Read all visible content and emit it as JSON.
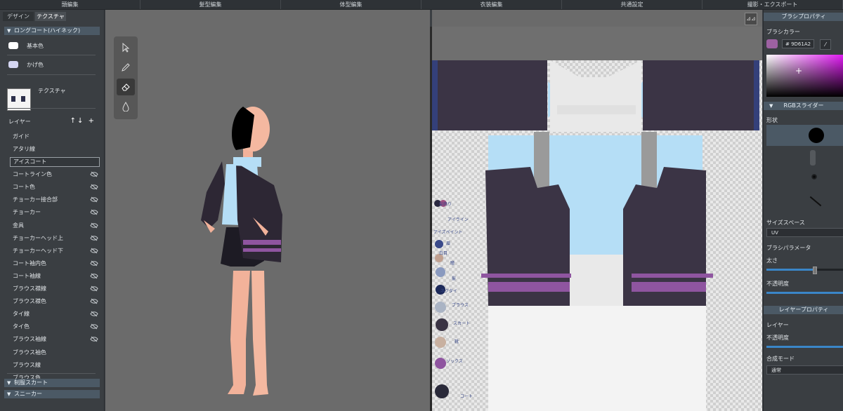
{
  "menu": [
    "頭編集",
    "髪型編集",
    "体型編集",
    "衣装編集",
    "共通設定",
    "撮影・エクスポート"
  ],
  "left": {
    "tabs": [
      "デザイン",
      "テクスチャ"
    ],
    "section_main": "ロングコート(ハイネック)",
    "colors": [
      {
        "label": "基本色",
        "hex": "#FFFFFF"
      },
      {
        "label": "かげ色",
        "hex": "#D4D6F2"
      }
    ],
    "texture_label": "テクスチャ",
    "layer_header": "レイヤー",
    "layers": [
      {
        "name": "ガイド",
        "hidden": false,
        "selected": false
      },
      {
        "name": "アタリ線",
        "hidden": false,
        "selected": false
      },
      {
        "name": "アイスコート",
        "hidden": false,
        "selected": true
      },
      {
        "name": "コートライン色",
        "hidden": true,
        "selected": false
      },
      {
        "name": "コート色",
        "hidden": true,
        "selected": false
      },
      {
        "name": "チョーカー接合部",
        "hidden": true,
        "selected": false
      },
      {
        "name": "チョーカー",
        "hidden": true,
        "selected": false
      },
      {
        "name": "金具",
        "hidden": true,
        "selected": false
      },
      {
        "name": "チョーカーヘッド上",
        "hidden": true,
        "selected": false
      },
      {
        "name": "チョーカーヘッド下",
        "hidden": true,
        "selected": false
      },
      {
        "name": "コート袖内色",
        "hidden": true,
        "selected": false
      },
      {
        "name": "コート袖線",
        "hidden": true,
        "selected": false
      },
      {
        "name": "ブラウス襟線",
        "hidden": true,
        "selected": false
      },
      {
        "name": "ブラウス襟色",
        "hidden": true,
        "selected": false
      },
      {
        "name": "タイ線",
        "hidden": true,
        "selected": false
      },
      {
        "name": "タイ色",
        "hidden": true,
        "selected": false
      },
      {
        "name": "ブラウス袖線",
        "hidden": true,
        "selected": false
      },
      {
        "name": "ブラウス袖色",
        "hidden": false,
        "selected": false
      },
      {
        "name": "ブラウス線",
        "hidden": false,
        "selected": false
      },
      {
        "name": "ブラウス色",
        "hidden": false,
        "selected": false
      }
    ],
    "section_skirt": "制服スカート",
    "section_sneaker": "スニーカー"
  },
  "uv_labels": [
    "髪飾り",
    "アイライン",
    "アイズペイント",
    "眉",
    "白目",
    "瞳",
    "髪",
    "ネクタイ",
    "ブラウス",
    "スカート",
    "靴",
    "ソックス",
    "コート"
  ],
  "uv_tool_icon": "flip-icon",
  "right": {
    "brush_props": "ブラシプロパティ",
    "brush_color_label": "ブラシカラー",
    "brush_hex": "# 9D61A2",
    "brush_color": "#9D61A2",
    "rgb_slider": "RGBスライダー",
    "shape_label": "形状",
    "size_space_label": "サイズスペース",
    "size_space_value": "UV",
    "brush_params": "ブラシパラメータ",
    "thickness_label": "太さ",
    "thickness": 0.62,
    "opacity_label": "不透明度",
    "opacity": 1.0,
    "layer_props": "レイヤープロパティ",
    "layer_label": "レイヤー",
    "layer_opacity_label": "不透明度",
    "layer_opacity": 1.0,
    "blend_label": "合成モード",
    "blend_value": "通常"
  },
  "tools": [
    "select-arrow-icon",
    "pencil-icon",
    "eraser-icon",
    "drop-icon"
  ]
}
